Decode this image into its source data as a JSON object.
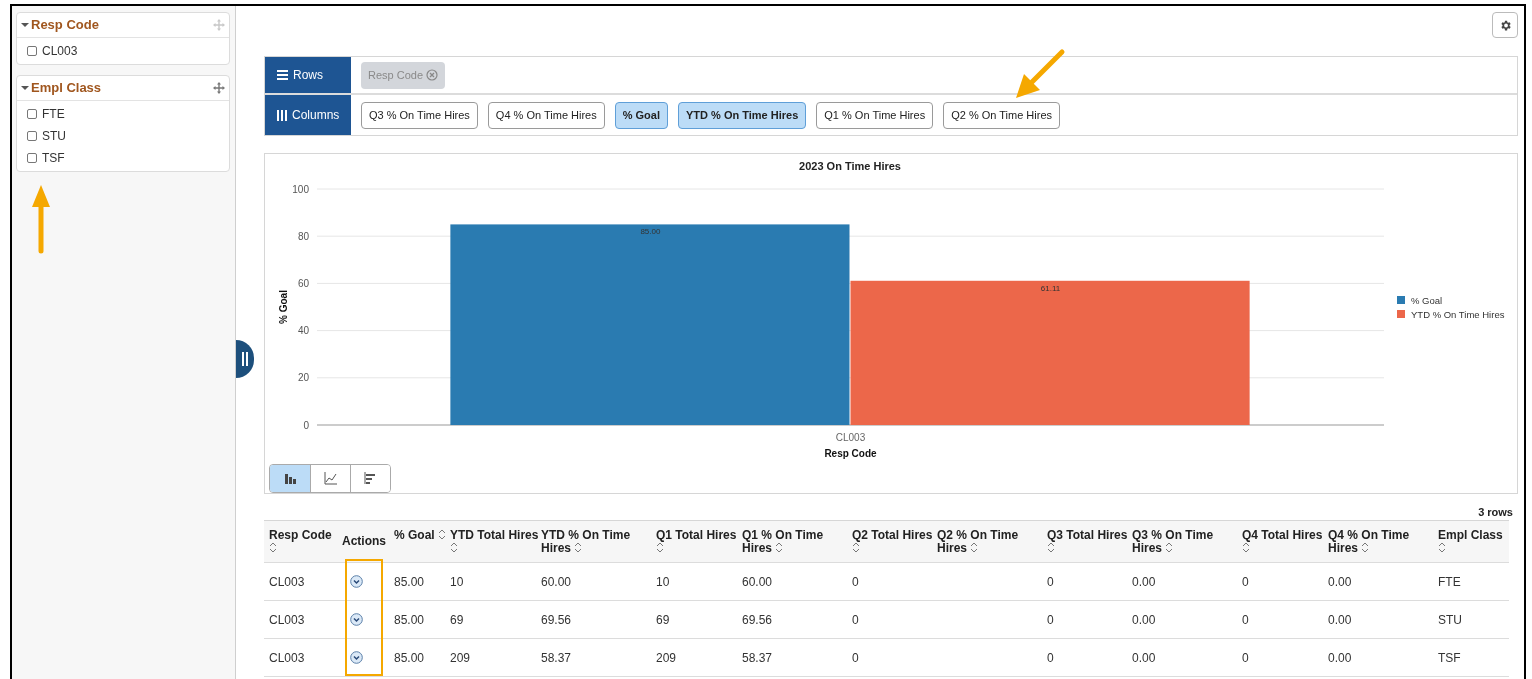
{
  "sidebar": {
    "facets": [
      {
        "title": "Resp Code",
        "expanded": true,
        "options": [
          {
            "label": "CL003",
            "checked": false
          }
        ]
      },
      {
        "title": "Empl Class",
        "expanded": true,
        "options": [
          {
            "label": "FTE",
            "checked": false
          },
          {
            "label": "STU",
            "checked": false
          },
          {
            "label": "TSF",
            "checked": false
          }
        ]
      }
    ]
  },
  "pivot": {
    "rows": {
      "label": "Rows",
      "chips": [
        {
          "label": "Resp Code",
          "removable": true
        }
      ]
    },
    "columns": {
      "label": "Columns",
      "chips": [
        {
          "label": "Q3 % On Time Hires",
          "selected": false
        },
        {
          "label": "Q4 % On Time Hires",
          "selected": false
        },
        {
          "label": "% Goal",
          "selected": true
        },
        {
          "label": "YTD % On Time Hires",
          "selected": true
        },
        {
          "label": "Q1 % On Time Hires",
          "selected": false
        },
        {
          "label": "Q2 % On Time Hires",
          "selected": false
        }
      ]
    }
  },
  "chart": {
    "chart_data": {
      "type": "bar",
      "title": "2023 On Time Hires",
      "xlabel": "Resp Code",
      "ylabel": "% Goal",
      "categories": [
        "CL003"
      ],
      "series": [
        {
          "name": "% Goal",
          "color": "#2a7bb1",
          "values": [
            85
          ]
        },
        {
          "name": "YTD % On Time Hires",
          "color": "#ec674a",
          "values": [
            61.11
          ]
        }
      ],
      "ylim": [
        0,
        100
      ],
      "yticks": [
        0,
        20,
        40,
        60,
        80,
        100
      ],
      "value_labels": [
        [
          "85.00"
        ],
        [
          "61.11"
        ]
      ],
      "grid": true,
      "legend": true
    },
    "view_buttons": [
      {
        "kind": "bar",
        "selected": true
      },
      {
        "kind": "line",
        "selected": false
      },
      {
        "kind": "horizontal-bar",
        "selected": false
      }
    ]
  },
  "table": {
    "row_count": "3 rows",
    "columns": [
      {
        "label": "Resp Code",
        "kind": "data"
      },
      {
        "label": "Actions",
        "kind": "actions"
      },
      {
        "label": "% Goal",
        "kind": "data"
      },
      {
        "label": "YTD Total Hires",
        "kind": "data"
      },
      {
        "label": "YTD % On Time Hires",
        "kind": "data"
      },
      {
        "label": "Q1 Total Hires",
        "kind": "data"
      },
      {
        "label": "Q1 % On Time Hires",
        "kind": "data"
      },
      {
        "label": "Q2 Total Hires",
        "kind": "data"
      },
      {
        "label": "Q2 % On Time Hires",
        "kind": "blank"
      },
      {
        "label": "Q3 Total Hires",
        "kind": "data"
      },
      {
        "label": "Q3 % On Time Hires",
        "kind": "data"
      },
      {
        "label": "Q4 Total Hires",
        "kind": "data"
      },
      {
        "label": "Q4 % On Time Hires",
        "kind": "data"
      },
      {
        "label": "Empl Class",
        "kind": "data"
      }
    ],
    "rows": [
      {
        "cells": [
          "CL003",
          "",
          "85.00",
          "10",
          "60.00",
          "10",
          "60.00",
          "0",
          "",
          "0",
          "0.00",
          "0",
          "0.00",
          "FTE"
        ]
      },
      {
        "cells": [
          "CL003",
          "",
          "85.00",
          "69",
          "69.56",
          "69",
          "69.56",
          "0",
          "",
          "0",
          "0.00",
          "0",
          "0.00",
          "STU"
        ]
      },
      {
        "cells": [
          "CL003",
          "",
          "85.00",
          "209",
          "58.37",
          "209",
          "58.37",
          "0",
          "",
          "0",
          "0.00",
          "0",
          "0.00",
          "TSF"
        ]
      }
    ]
  }
}
